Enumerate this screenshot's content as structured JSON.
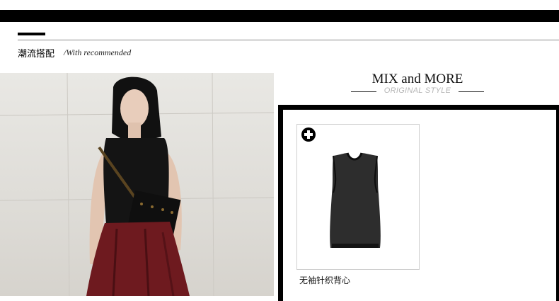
{
  "section": {
    "title": "潮流搭配",
    "subtitle": "/With recommended"
  },
  "mix": {
    "title": "MIX and MORE",
    "subtitle": "ORIGINAL STYLE"
  },
  "product": {
    "name": "无袖针织背心",
    "add_icon": "plus-circle-icon"
  },
  "colors": {
    "bar": "#000000",
    "skirt": "#6e1a1f",
    "muted_subtitle": "#b5b5b5"
  }
}
